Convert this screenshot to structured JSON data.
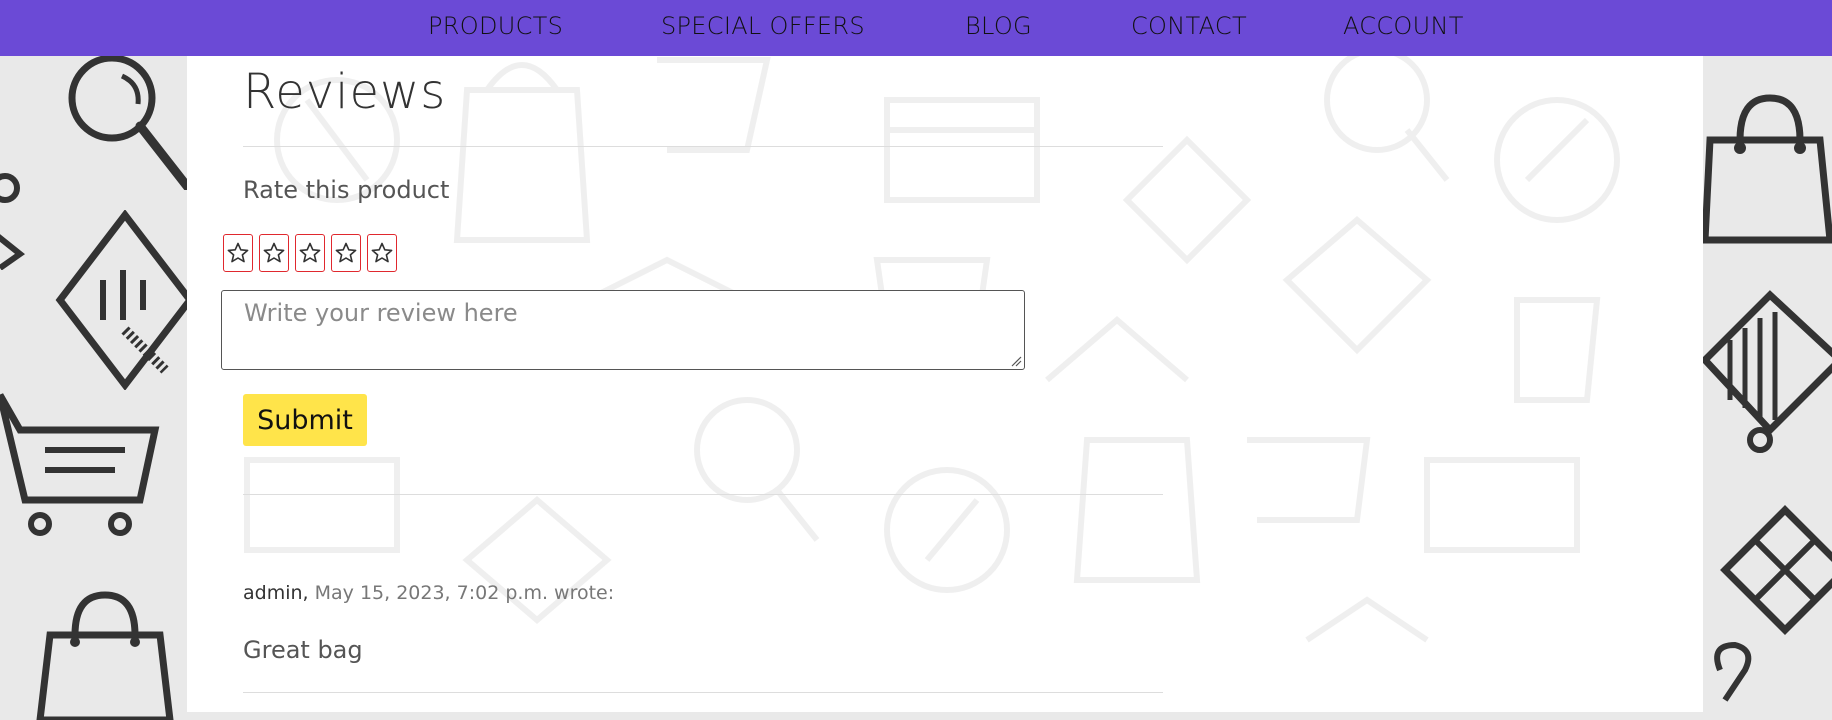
{
  "nav": {
    "items": [
      "PRODUCTS",
      "SPECIAL OFFERS",
      "BLOG",
      "CONTACT",
      "ACCOUNT"
    ]
  },
  "reviews": {
    "title": "Reviews",
    "rate_label": "Rate this product",
    "stars_count": 5,
    "review_placeholder": "Write your review here",
    "submit_label": "Submit"
  },
  "review_list": [
    {
      "author": "admin,",
      "date_text": "May 15, 2023, 7:02 p.m. wrote:",
      "body": "Great bag"
    }
  ],
  "colors": {
    "nav_bg": "#6b4ad6",
    "submit_bg": "#ffe44a",
    "star_border": "#e0282e",
    "page_bg": "#e9e9e9"
  },
  "icons": {
    "star": "star-outline-icon",
    "background": [
      "magnifier-icon",
      "laptop-icon",
      "cart-icon",
      "shopping-bag-icon",
      "gift-box-icon",
      "hanger-icon"
    ]
  }
}
